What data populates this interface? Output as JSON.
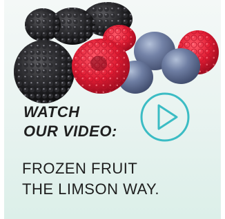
{
  "promo": {
    "headline_line1": "WATCH",
    "headline_line2": "OUR VIDEO:",
    "subtitle_line1": "FROZEN FRUIT",
    "subtitle_line2": "THE LIMSON WAY.",
    "accent_color": "#3bbcc4",
    "image_icon": "mixed-berries-image",
    "play_icon": "play-circle-icon"
  }
}
